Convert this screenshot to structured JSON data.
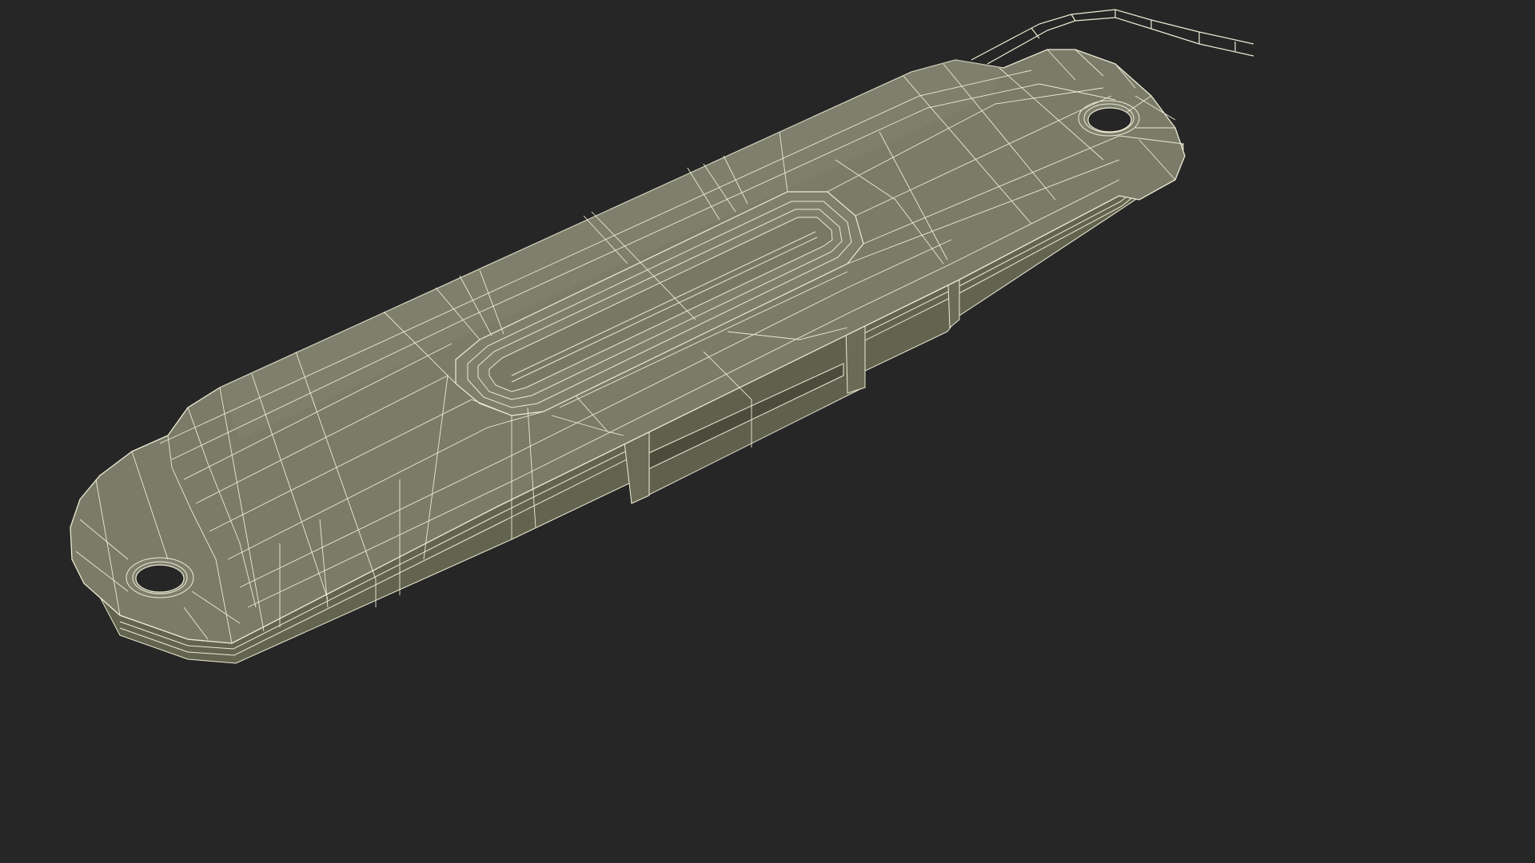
{
  "scene": {
    "background_color": "#262626",
    "object": "wireframe-mounting-plate-with-cable",
    "surface_color": "#7a7b69",
    "surface_light_color": "#85877a",
    "surface_dark_color": "#63644f",
    "wire_color": "#ecebd5"
  }
}
